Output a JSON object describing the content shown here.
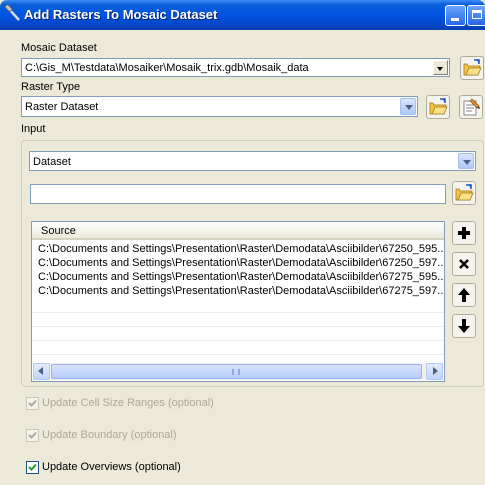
{
  "window": {
    "title": "Add Rasters To Mosaic Dataset",
    "minimize_icon": "minimize-icon",
    "maximize_icon": "maximize-icon"
  },
  "mosaic_dataset": {
    "label": "Mosaic Dataset",
    "value": "C:\\Gis_M\\Testdata\\Mosaiker\\Mosaik_trix.gdb\\Mosaik_data"
  },
  "raster_type": {
    "label": "Raster Type",
    "value": "Raster Dataset"
  },
  "input": {
    "label": "Input",
    "type_value": "Dataset",
    "path_value": "",
    "source_header": "Source",
    "sources": [
      "C:\\Documents and Settings\\Presentation\\Raster\\Demodata\\Asciibilder\\67250_595...",
      "C:\\Documents and Settings\\Presentation\\Raster\\Demodata\\Asciibilder\\67250_597...",
      "C:\\Documents and Settings\\Presentation\\Raster\\Demodata\\Asciibilder\\67275_595...",
      "C:\\Documents and Settings\\Presentation\\Raster\\Demodata\\Asciibilder\\67275_597..."
    ]
  },
  "options": {
    "update_cell_size": {
      "label": "Update Cell Size Ranges (optional)",
      "checked": true,
      "enabled": false
    },
    "update_boundary": {
      "label": "Update Boundary (optional)",
      "checked": true,
      "enabled": false
    },
    "update_overviews": {
      "label": "Update Overviews (optional)",
      "checked": true,
      "enabled": true
    }
  },
  "colors": {
    "titlebar": "#0054e3",
    "dialog_bg": "#ece9d8",
    "field_border": "#7f9db9",
    "folder": "#f5c342",
    "check_green": "#21a121"
  }
}
